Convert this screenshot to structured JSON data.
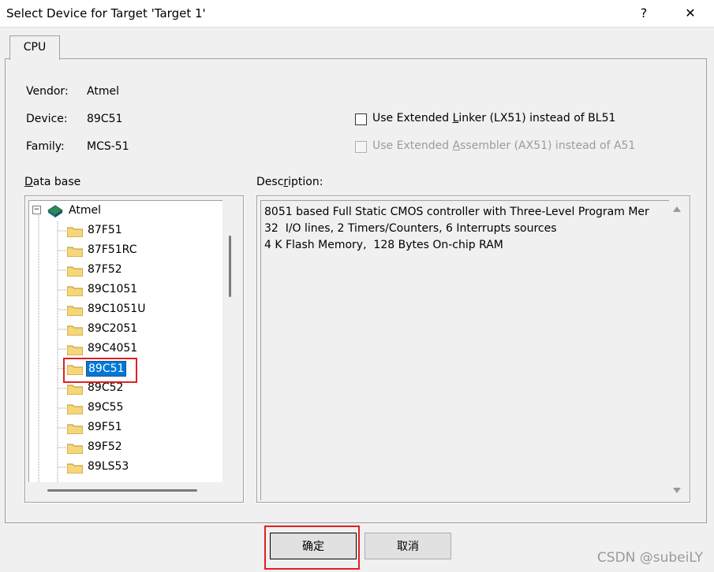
{
  "window": {
    "title": "Select Device for Target 'Target 1'",
    "help_glyph": "?",
    "close_glyph": "✕"
  },
  "tabs": [
    {
      "label": "CPU"
    }
  ],
  "device_info": {
    "vendor_label": "Vendor:",
    "vendor_value": "Atmel",
    "device_label": "Device:",
    "device_value": "89C51",
    "family_label": "Family:",
    "family_value": "MCS-51"
  },
  "options": {
    "linker_pre": "Use Extended ",
    "linker_key": "L",
    "linker_post": "inker (LX51) instead of BL51",
    "assembler_pre": "Use Extended ",
    "assembler_key": "A",
    "assembler_post": "ssembler (AX51) instead of A51"
  },
  "database": {
    "label_key": "D",
    "label_rest": "ata base",
    "root": "Atmel",
    "root_toggle": "⊟",
    "items": [
      "87F51",
      "87F51RC",
      "87F52",
      "89C1051",
      "89C1051U",
      "89C2051",
      "89C4051",
      "89C51",
      "89C52",
      "89C55",
      "89F51",
      "89F52",
      "89LS53"
    ],
    "selected": "89C51"
  },
  "description": {
    "label_pre": "Desc",
    "label_key": "r",
    "label_post": "iption:",
    "text": "8051 based Full Static CMOS controller with Three-Level Program Mer\n32  I/O lines, 2 Timers/Counters, 6 Interrupts sources\n4 K Flash Memory,  128 Bytes On-chip RAM"
  },
  "buttons": {
    "ok": "确定",
    "cancel": "取消"
  },
  "watermark": "CSDN @subeiLY",
  "colors": {
    "selection": "#0078d7",
    "highlight_box": "#e02020",
    "folder": "#f5d77a"
  }
}
